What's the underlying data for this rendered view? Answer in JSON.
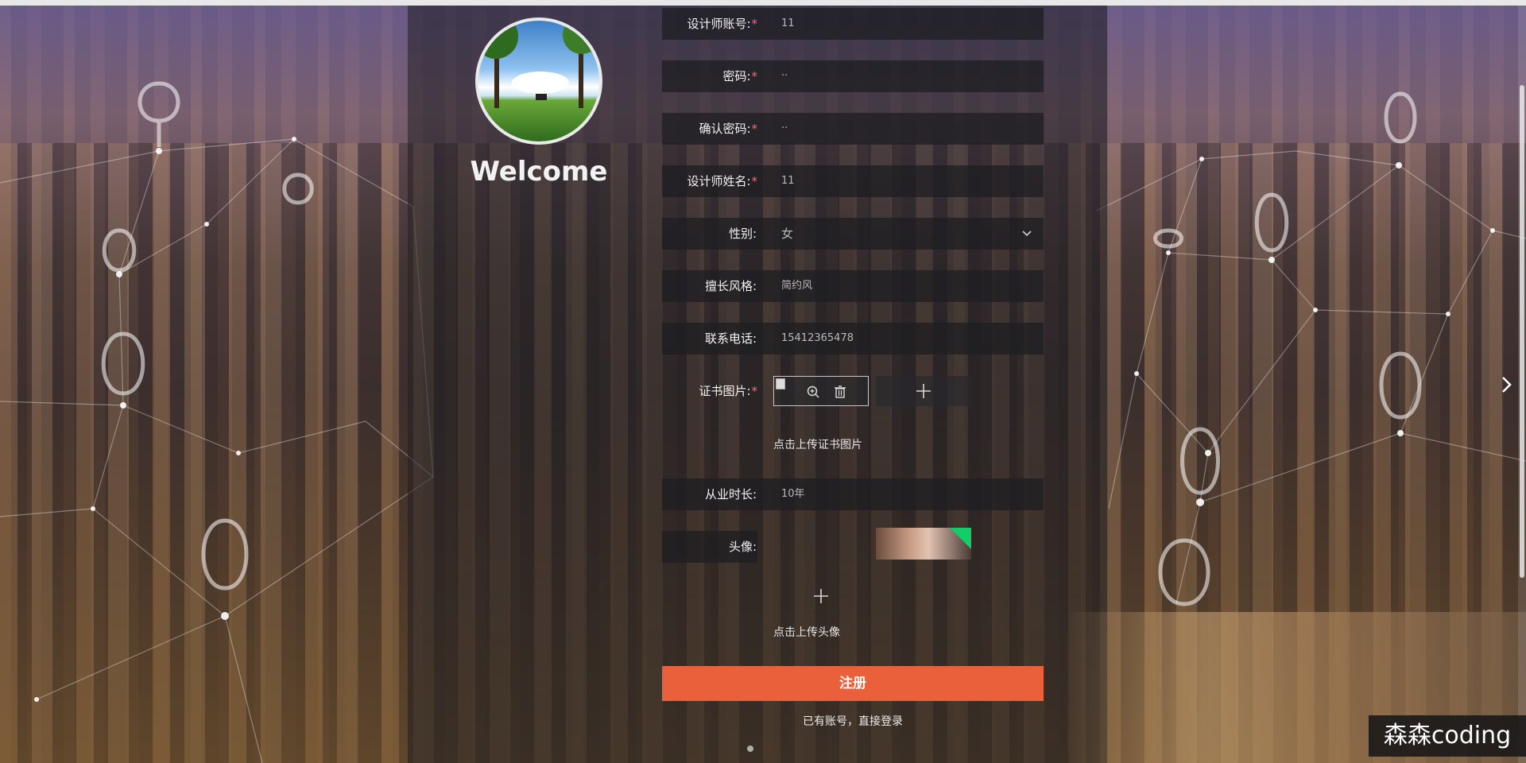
{
  "welcome": "Welcome",
  "form": {
    "rows": [
      {
        "label": "设计师账号:",
        "required": "*",
        "value": "11"
      },
      {
        "label": "密码:",
        "required": "*",
        "value": "··"
      },
      {
        "label": "确认密码:",
        "required": "*",
        "value": "··"
      },
      {
        "label": "设计师姓名:",
        "required": "*",
        "value": "11"
      },
      {
        "label": "性别:",
        "required": "",
        "value": "女"
      },
      {
        "label": "擅长风格:",
        "required": "",
        "value": "简约风"
      },
      {
        "label": "联系电话:",
        "required": "",
        "value": "15412365478"
      },
      {
        "label": "证书图片:",
        "required": "*"
      },
      {
        "label": "从业时长:",
        "required": "",
        "value": "10年"
      },
      {
        "label": "头像:",
        "required": ""
      }
    ],
    "cert_hint": "点击上传证书图片",
    "avatar_hint": "点击上传头像"
  },
  "register_button": "注册",
  "login_link": "已有账号，直接登录",
  "watermark": "森森coding",
  "colors": {
    "accent": "#e9603a",
    "required": "#f56c6c",
    "success": "#13ce66"
  },
  "icons": [
    "zoom-in-icon",
    "delete-icon",
    "plus-icon",
    "chevron-down-icon",
    "chevron-right-icon"
  ]
}
